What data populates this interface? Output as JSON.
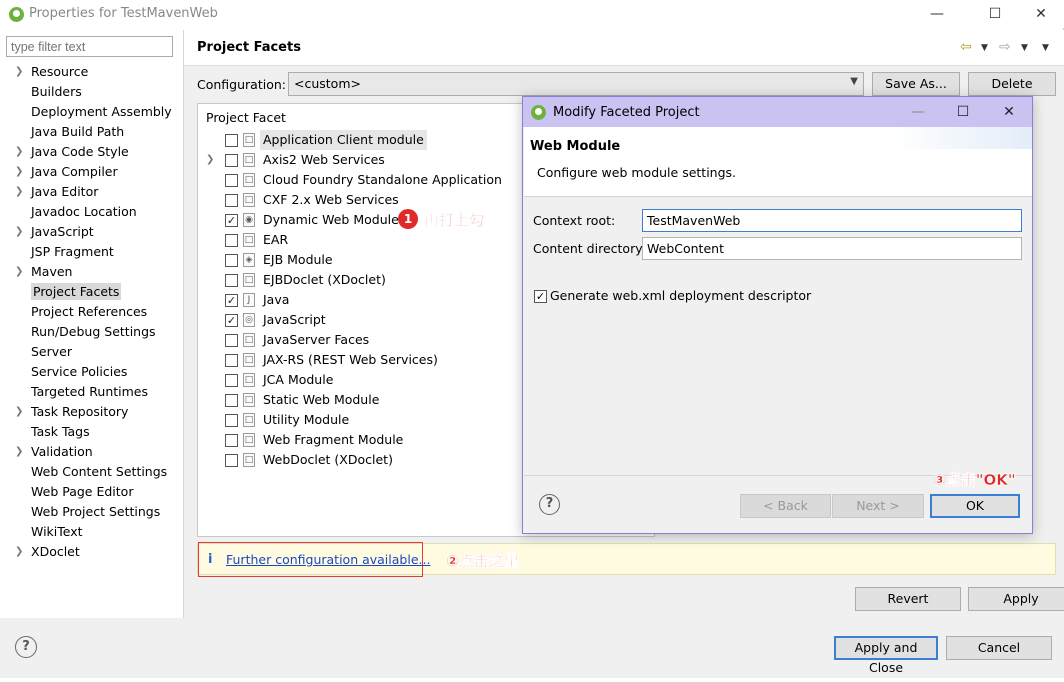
{
  "window": {
    "title": "Properties for TestMavenWeb",
    "min_glyph": "—",
    "max_glyph": "☐",
    "close_glyph": "✕"
  },
  "filter": {
    "placeholder": "type filter text"
  },
  "tree": [
    {
      "label": "Resource",
      "expandable": true
    },
    {
      "label": "Builders",
      "expandable": false
    },
    {
      "label": "Deployment Assembly",
      "expandable": false
    },
    {
      "label": "Java Build Path",
      "expandable": false
    },
    {
      "label": "Java Code Style",
      "expandable": true
    },
    {
      "label": "Java Compiler",
      "expandable": true
    },
    {
      "label": "Java Editor",
      "expandable": true
    },
    {
      "label": "Javadoc Location",
      "expandable": false
    },
    {
      "label": "JavaScript",
      "expandable": true
    },
    {
      "label": "JSP Fragment",
      "expandable": false
    },
    {
      "label": "Maven",
      "expandable": true
    },
    {
      "label": "Project Facets",
      "expandable": false,
      "selected": true
    },
    {
      "label": "Project References",
      "expandable": false
    },
    {
      "label": "Run/Debug Settings",
      "expandable": false
    },
    {
      "label": "Server",
      "expandable": false
    },
    {
      "label": "Service Policies",
      "expandable": false
    },
    {
      "label": "Targeted Runtimes",
      "expandable": false
    },
    {
      "label": "Task Repository",
      "expandable": true
    },
    {
      "label": "Task Tags",
      "expandable": false
    },
    {
      "label": "Validation",
      "expandable": true
    },
    {
      "label": "Web Content Settings",
      "expandable": false
    },
    {
      "label": "Web Page Editor",
      "expandable": false
    },
    {
      "label": "Web Project Settings",
      "expandable": false
    },
    {
      "label": "WikiText",
      "expandable": false
    },
    {
      "label": "XDoclet",
      "expandable": true
    }
  ],
  "panel": {
    "title": "Project Facets",
    "config_label": "Configuration:",
    "config_value": "<custom>",
    "save_as": "Save As...",
    "delete": "Delete",
    "facet_header": "Project Facet",
    "revert": "Revert",
    "apply": "Apply"
  },
  "facets": [
    {
      "label": "Application Client module",
      "checked": false,
      "highlighted": true,
      "icon": "□"
    },
    {
      "label": "Axis2 Web Services",
      "checked": false,
      "expandable": true,
      "icon": "□"
    },
    {
      "label": "Cloud Foundry Standalone Application",
      "checked": false,
      "icon": "□"
    },
    {
      "label": "CXF 2.x Web Services",
      "checked": false,
      "icon": "□"
    },
    {
      "label": "Dynamic Web Module",
      "checked": true,
      "icon": "◉"
    },
    {
      "label": "EAR",
      "checked": false,
      "icon": "□"
    },
    {
      "label": "EJB Module",
      "checked": false,
      "icon": "◈"
    },
    {
      "label": "EJBDoclet (XDoclet)",
      "checked": false,
      "icon": "□"
    },
    {
      "label": "Java",
      "checked": true,
      "icon": "J"
    },
    {
      "label": "JavaScript",
      "checked": true,
      "icon": "◎"
    },
    {
      "label": "JavaServer Faces",
      "checked": false,
      "icon": "□"
    },
    {
      "label": "JAX-RS (REST Web Services)",
      "checked": false,
      "icon": "□"
    },
    {
      "label": "JCA Module",
      "checked": false,
      "icon": "□"
    },
    {
      "label": "Static Web Module",
      "checked": false,
      "icon": "□"
    },
    {
      "label": "Utility Module",
      "checked": false,
      "icon": "□"
    },
    {
      "label": "Web Fragment Module",
      "checked": false,
      "icon": "□"
    },
    {
      "label": "WebDoclet (XDoclet)",
      "checked": false,
      "icon": "□"
    }
  ],
  "info": {
    "icon": "i",
    "link": "Further configuration available..."
  },
  "annotations": {
    "step1_num": "1",
    "step1_text": "再打上勾",
    "step2_text": "②点击这里",
    "step3_text": "③点击\"OK\""
  },
  "dialog": {
    "title": "Modify Faceted Project",
    "heading": "Web Module",
    "description": "Configure web module settings.",
    "context_root_label": "Context root:",
    "context_root_value": "TestMavenWeb",
    "content_dir_label": "Content directory:",
    "content_dir_value": "WebContent",
    "generate_label": "Generate web.xml deployment descriptor",
    "generate_checked": true,
    "back": "< Back",
    "next": "Next >",
    "ok": "OK",
    "help_glyph": "?",
    "min_glyph": "—",
    "max_glyph": "☐",
    "close_glyph": "✕"
  },
  "footer": {
    "help_glyph": "?",
    "apply_close": "Apply and Close",
    "cancel": "Cancel"
  },
  "colors": {
    "annotation_red": "#e02a2a",
    "dialog_title_bg": "#cac3f2",
    "link_blue": "#1a47c3",
    "info_bg": "#fffbe0"
  }
}
